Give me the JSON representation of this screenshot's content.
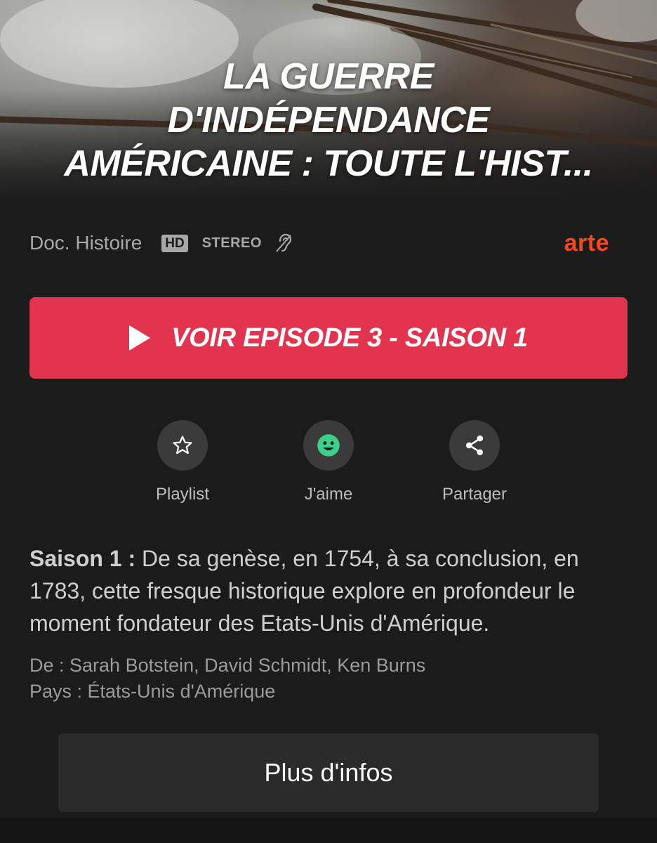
{
  "hero": {
    "title": "LA GUERRE\nD'INDÉPENDANCE\nAMÉRICAINE : TOUTE L'HIST..."
  },
  "meta": {
    "genre": "Doc. Histoire",
    "hd_badge": "HD",
    "stereo": "STEREO",
    "accessibility_icon": "hearing-impaired-icon",
    "channel_logo": "arte",
    "channel_color": "#fa481c"
  },
  "play_button": {
    "label": "VOIR EPISODE 3 - SAISON 1",
    "color": "#e2344e",
    "icon": "play-icon"
  },
  "actions": [
    {
      "label": "Playlist",
      "icon": "star-icon"
    },
    {
      "label": "J'aime",
      "icon": "smiley-icon",
      "icon_color": "#3cd08a"
    },
    {
      "label": "Partager",
      "icon": "share-icon"
    }
  ],
  "description": {
    "season": "Saison 1 :",
    "text": "De sa genèse, en 1754, à sa conclusion, en 1783, cette fresque historique explore en profondeur le moment fondateur des Etats-Unis d'Amérique."
  },
  "credits": {
    "authors": "De : Sarah Botstein, David Schmidt, Ken Burns",
    "country": "Pays : États-Unis d'Amérique"
  },
  "more_button": {
    "label": "Plus d'infos"
  }
}
